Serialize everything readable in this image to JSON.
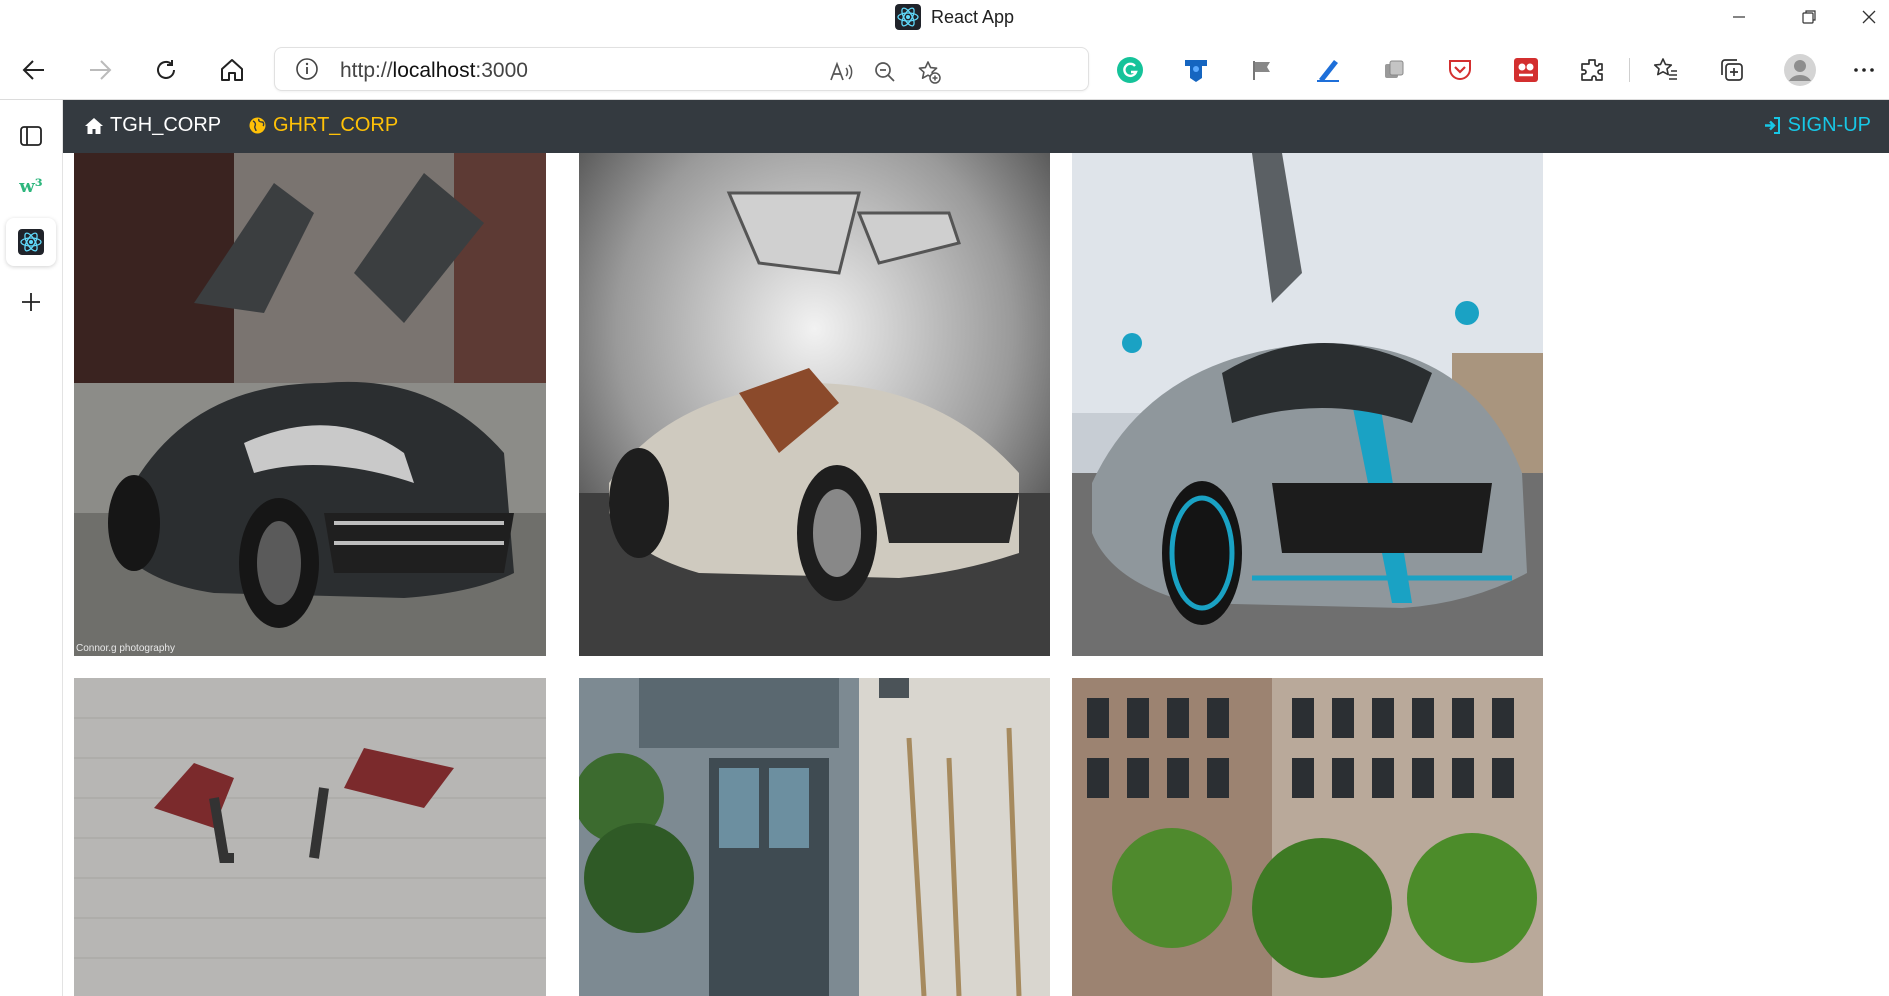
{
  "window": {
    "title": "React App",
    "controls": [
      "minimize-icon",
      "restore-icon",
      "close-icon"
    ]
  },
  "browser": {
    "url_scheme": "http://",
    "url_host": "localhost",
    "url_port": ":3000",
    "toolbar_icons": [
      "back-icon",
      "forward-icon",
      "refresh-icon",
      "home-icon",
      "site-info-icon",
      "read-aloud-icon",
      "zoom-out-icon",
      "add-favorite-icon",
      "grammarly-icon",
      "extension-shield-icon",
      "flag-icon",
      "pen-icon",
      "copy-icon",
      "pocket-icon",
      "game-icon",
      "extensions-icon",
      "favorites-icon",
      "collections-icon",
      "profile-icon",
      "more-icon"
    ]
  },
  "sidebar": {
    "items": [
      "tabs-icon",
      "w3-icon",
      "react-tab-icon",
      "add-icon"
    ],
    "w3_label": "w³"
  },
  "navbar": {
    "brand": "TGH_CORP",
    "link": "GHRT_CORP",
    "signup": "SIGN-UP",
    "colors": {
      "bg": "#343a40",
      "brand": "#ffffff",
      "link": "#ffc107",
      "signup": "#17c7e6"
    }
  },
  "gallery": {
    "photo_credit": "Connor.g photography"
  }
}
